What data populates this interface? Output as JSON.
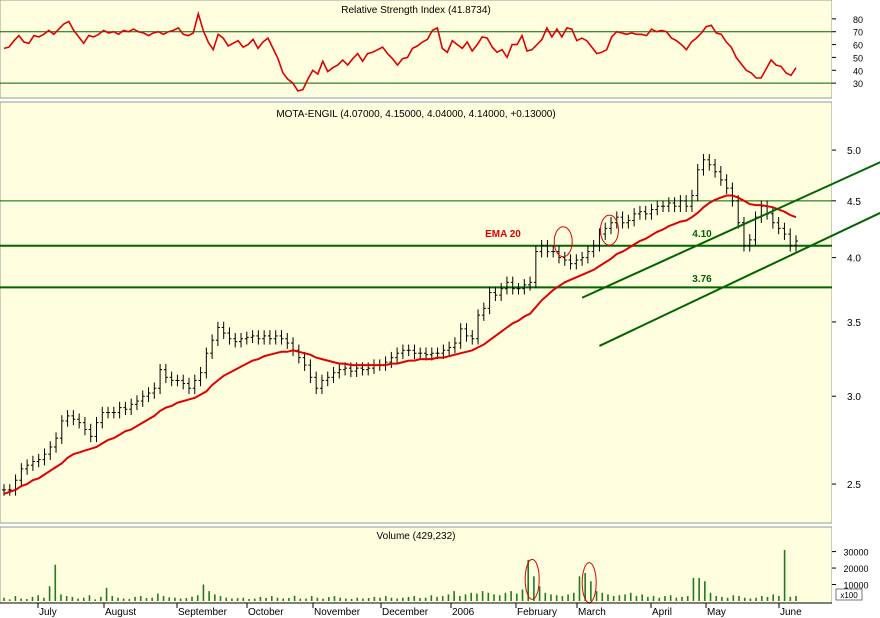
{
  "colors": {
    "panel_bg": "#FFFFDF",
    "price_bar": "#000000",
    "rsi_line": "#E00000",
    "ema_line": "#E00000",
    "volume_bar": "#207A20",
    "channel": "#006400",
    "support": "#006400",
    "annotation": "#E00000"
  },
  "chart_data": [
    {
      "type": "line",
      "panel": "rsi",
      "title": "Relative Strength Index (41.8734)",
      "ylim": [
        20,
        90
      ],
      "y_ticks": [
        "80",
        "70",
        "60",
        "50",
        "40",
        "30"
      ],
      "reference_lines": [
        70,
        30
      ],
      "series": [
        {
          "values": [
            57,
            58,
            63,
            67,
            62,
            61,
            67,
            66,
            68,
            71,
            68,
            72,
            76,
            78,
            71,
            66,
            61,
            67,
            66,
            68,
            71,
            69,
            70,
            68,
            71,
            70,
            72,
            70,
            69,
            67,
            69,
            70,
            68,
            70,
            71,
            73,
            68,
            67,
            69,
            84,
            71,
            62,
            56,
            68,
            65,
            59,
            61,
            63,
            58,
            60,
            64,
            57,
            62,
            65,
            57,
            49,
            38,
            33,
            30,
            24,
            25,
            33,
            40,
            37,
            47,
            39,
            42,
            44,
            48,
            44,
            49,
            53,
            47,
            53,
            54,
            56,
            58,
            53,
            49,
            44,
            49,
            50,
            57,
            59,
            62,
            64,
            71,
            73,
            57,
            54,
            63,
            60,
            57,
            62,
            55,
            60,
            66,
            65,
            58,
            54,
            56,
            50,
            60,
            60,
            67,
            55,
            56,
            60,
            64,
            73,
            66,
            72,
            66,
            73,
            72,
            63,
            65,
            63,
            58,
            53,
            54,
            56,
            66,
            70,
            69,
            68,
            69,
            68,
            68,
            67,
            72,
            70,
            71,
            70,
            65,
            63,
            60,
            56,
            62,
            65,
            69,
            74,
            75,
            69,
            68,
            62,
            58,
            50,
            45,
            40,
            38,
            34,
            34,
            41,
            48,
            44,
            43,
            38,
            36,
            42
          ]
        }
      ]
    },
    {
      "type": "line",
      "panel": "price",
      "title": "MOTA-ENGIL (4.07000, 4.15000, 4.04000, 4.14000, +0.13000)",
      "y_scale": "log",
      "ylim": [
        2.33,
        5.3
      ],
      "y_ticks": [
        "5.0",
        "4.5",
        "4.0",
        "3.5",
        "3.0",
        "2.5"
      ],
      "x_ticks": [
        "July",
        "August",
        "September",
        "October",
        "November",
        "December",
        "2006",
        "February",
        "March",
        "April",
        "May",
        "June"
      ],
      "close_series_note": "daily closes from July 2005 to June 2006",
      "series": [
        {
          "name": "MOTA-ENGIL",
          "values": [
            2.47,
            2.47,
            2.52,
            2.58,
            2.6,
            2.62,
            2.63,
            2.66,
            2.7,
            2.75,
            2.85,
            2.88,
            2.86,
            2.84,
            2.8,
            2.76,
            2.84,
            2.9,
            2.9,
            2.9,
            2.93,
            2.92,
            2.95,
            2.97,
            3.0,
            3.02,
            3.05,
            3.17,
            3.12,
            3.1,
            3.1,
            3.08,
            3.05,
            3.1,
            3.15,
            3.28,
            3.37,
            3.46,
            3.42,
            3.38,
            3.36,
            3.38,
            3.39,
            3.4,
            3.38,
            3.4,
            3.38,
            3.4,
            3.38,
            3.35,
            3.3,
            3.25,
            3.2,
            3.12,
            3.05,
            3.1,
            3.12,
            3.15,
            3.17,
            3.18,
            3.16,
            3.18,
            3.17,
            3.18,
            3.2,
            3.2,
            3.22,
            3.25,
            3.28,
            3.3,
            3.3,
            3.28,
            3.28,
            3.27,
            3.28,
            3.28,
            3.3,
            3.32,
            3.35,
            3.45,
            3.4,
            3.38,
            3.55,
            3.6,
            3.72,
            3.7,
            3.75,
            3.8,
            3.75,
            3.75,
            3.78,
            3.8,
            4.05,
            4.1,
            4.05,
            4.05,
            4.0,
            3.98,
            3.95,
            3.98,
            4.0,
            4.05,
            4.1,
            4.2,
            4.25,
            4.3,
            4.35,
            4.3,
            4.32,
            4.38,
            4.4,
            4.38,
            4.42,
            4.45,
            4.45,
            4.48,
            4.45,
            4.5,
            4.45,
            4.55,
            4.8,
            4.9,
            4.85,
            4.78,
            4.7,
            4.62,
            4.5,
            4.3,
            4.1,
            4.15,
            4.35,
            4.45,
            4.38,
            4.3,
            4.25,
            4.2,
            4.1,
            4.14
          ]
        },
        {
          "name": "EMA 20",
          "values": [
            2.45,
            2.46,
            2.47,
            2.49,
            2.5,
            2.52,
            2.53,
            2.55,
            2.57,
            2.59,
            2.61,
            2.64,
            2.66,
            2.67,
            2.68,
            2.69,
            2.7,
            2.72,
            2.74,
            2.75,
            2.77,
            2.79,
            2.8,
            2.82,
            2.84,
            2.86,
            2.88,
            2.91,
            2.93,
            2.94,
            2.96,
            2.97,
            2.98,
            2.99,
            3.01,
            3.03,
            3.07,
            3.1,
            3.13,
            3.15,
            3.17,
            3.19,
            3.21,
            3.23,
            3.24,
            3.26,
            3.27,
            3.28,
            3.29,
            3.29,
            3.3,
            3.29,
            3.28,
            3.27,
            3.25,
            3.24,
            3.23,
            3.22,
            3.21,
            3.21,
            3.2,
            3.2,
            3.2,
            3.2,
            3.2,
            3.2,
            3.2,
            3.21,
            3.21,
            3.22,
            3.23,
            3.23,
            3.24,
            3.24,
            3.24,
            3.25,
            3.25,
            3.26,
            3.27,
            3.28,
            3.29,
            3.3,
            3.32,
            3.34,
            3.37,
            3.4,
            3.43,
            3.46,
            3.49,
            3.51,
            3.54,
            3.56,
            3.61,
            3.66,
            3.7,
            3.74,
            3.77,
            3.8,
            3.82,
            3.84,
            3.86,
            3.88,
            3.9,
            3.93,
            3.96,
            3.99,
            4.03,
            4.05,
            4.08,
            4.11,
            4.14,
            4.16,
            4.19,
            4.22,
            4.24,
            4.27,
            4.29,
            4.31,
            4.32,
            4.35,
            4.39,
            4.44,
            4.48,
            4.51,
            4.53,
            4.55,
            4.55,
            4.53,
            4.5,
            4.47,
            4.46,
            4.46,
            4.45,
            4.44,
            4.42,
            4.4,
            4.37,
            4.35
          ]
        }
      ],
      "horizontal_lines": [
        {
          "value": 4.5,
          "label": ""
        },
        {
          "value": 4.1,
          "label": "4.10"
        },
        {
          "value": 3.76,
          "label": "3.76"
        }
      ],
      "trend_channel": {
        "upper": [
          [
            100,
            3.68
          ],
          [
            158,
            5.05
          ]
        ],
        "lower": [
          [
            103,
            3.33
          ],
          [
            172,
            4.93
          ]
        ]
      },
      "annotations": [
        "EMA 20"
      ]
    },
    {
      "type": "bar",
      "panel": "volume",
      "title": "Volume (429,232)",
      "ylim": [
        0,
        34000
      ],
      "y_ticks": [
        "30000",
        "20000",
        "10000"
      ],
      "y_unit_label": "x100",
      "values": [
        2000,
        1000,
        3000,
        1500,
        1200,
        2500,
        3500,
        2000,
        9000,
        22000,
        4000,
        3000,
        2500,
        1500,
        2000,
        3500,
        1000,
        2500,
        8000,
        3000,
        2000,
        1500,
        1200,
        2500,
        3000,
        1800,
        2000,
        4500,
        3000,
        2200,
        2000,
        1500,
        1800,
        2600,
        3500,
        10000,
        6000,
        4000,
        3000,
        2000,
        1500,
        1800,
        2000,
        1200,
        1500,
        2500,
        1800,
        3000,
        2000,
        1500,
        1800,
        3200,
        1400,
        1500,
        3000,
        2000,
        1500,
        2400,
        3000,
        2000,
        1500,
        1200,
        2000,
        1500,
        1800,
        2500,
        2000,
        3000,
        2000,
        1500,
        2000,
        2500,
        3000,
        1800,
        2000,
        3500,
        2500,
        3000,
        4000,
        6000,
        3000,
        4000,
        5000,
        4500,
        6000,
        5000,
        4000,
        3500,
        5000,
        6000,
        4500,
        7000,
        25000,
        15000,
        9000,
        5000,
        4000,
        3500,
        3000,
        4000,
        5000,
        15000,
        17000,
        12000,
        6000,
        5000,
        4000,
        3000,
        3500,
        4000,
        5000,
        3000,
        4000,
        2500,
        3000,
        2000,
        3000,
        3500,
        2000,
        2500,
        3000,
        14000,
        14000,
        12000,
        5000,
        3000,
        2500,
        2000,
        3500,
        3000,
        2000,
        1500,
        2000,
        3000,
        2500,
        4000,
        3000,
        31000,
        2500,
        3000
      ]
    }
  ]
}
